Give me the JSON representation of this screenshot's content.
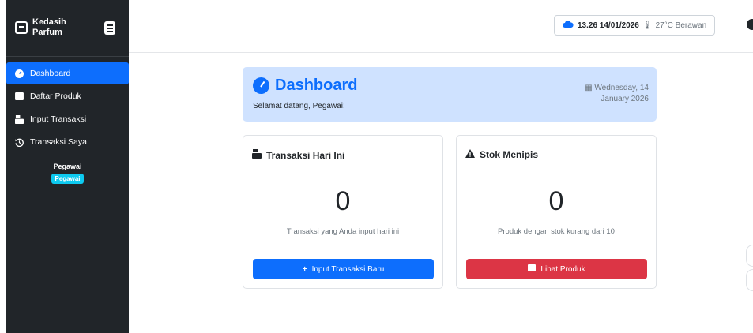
{
  "brand": {
    "name": "Kedasih Parfum"
  },
  "sidebar": {
    "items": [
      {
        "label": "Dashboard",
        "icon": "gauge-icon",
        "active": true
      },
      {
        "label": "Daftar Produk",
        "icon": "box-icon",
        "active": false
      },
      {
        "label": "Input Transaksi",
        "icon": "register-icon",
        "active": false
      },
      {
        "label": "Transaksi Saya",
        "icon": "history-icon",
        "active": false
      }
    ],
    "user": {
      "name": "Pegawai",
      "role_badge": "Pegawai"
    }
  },
  "topbar": {
    "weather": {
      "icon": "cloud-icon",
      "time": "13.26 14/01/2026",
      "temp": "27°C Berawan"
    }
  },
  "hero": {
    "title": "Dashboard",
    "subtitle": "Selamat datang, Pegawai!",
    "date": "Wednesday, 14 January 2026"
  },
  "cards": [
    {
      "title": "Transaksi Hari Ini",
      "value": "0",
      "description": "Transaksi yang Anda input hari ini",
      "button": "Input Transaksi Baru"
    },
    {
      "title": "Stok Menipis",
      "value": "0",
      "description": "Produk dengan stok kurang dari 10",
      "button": "Lihat Produk"
    }
  ],
  "colors": {
    "primary": "#0d6efd",
    "danger": "#dc3545",
    "sidebar": "#212529",
    "hero_bg": "#cfe2ff",
    "badge": "#0dcaf0"
  }
}
